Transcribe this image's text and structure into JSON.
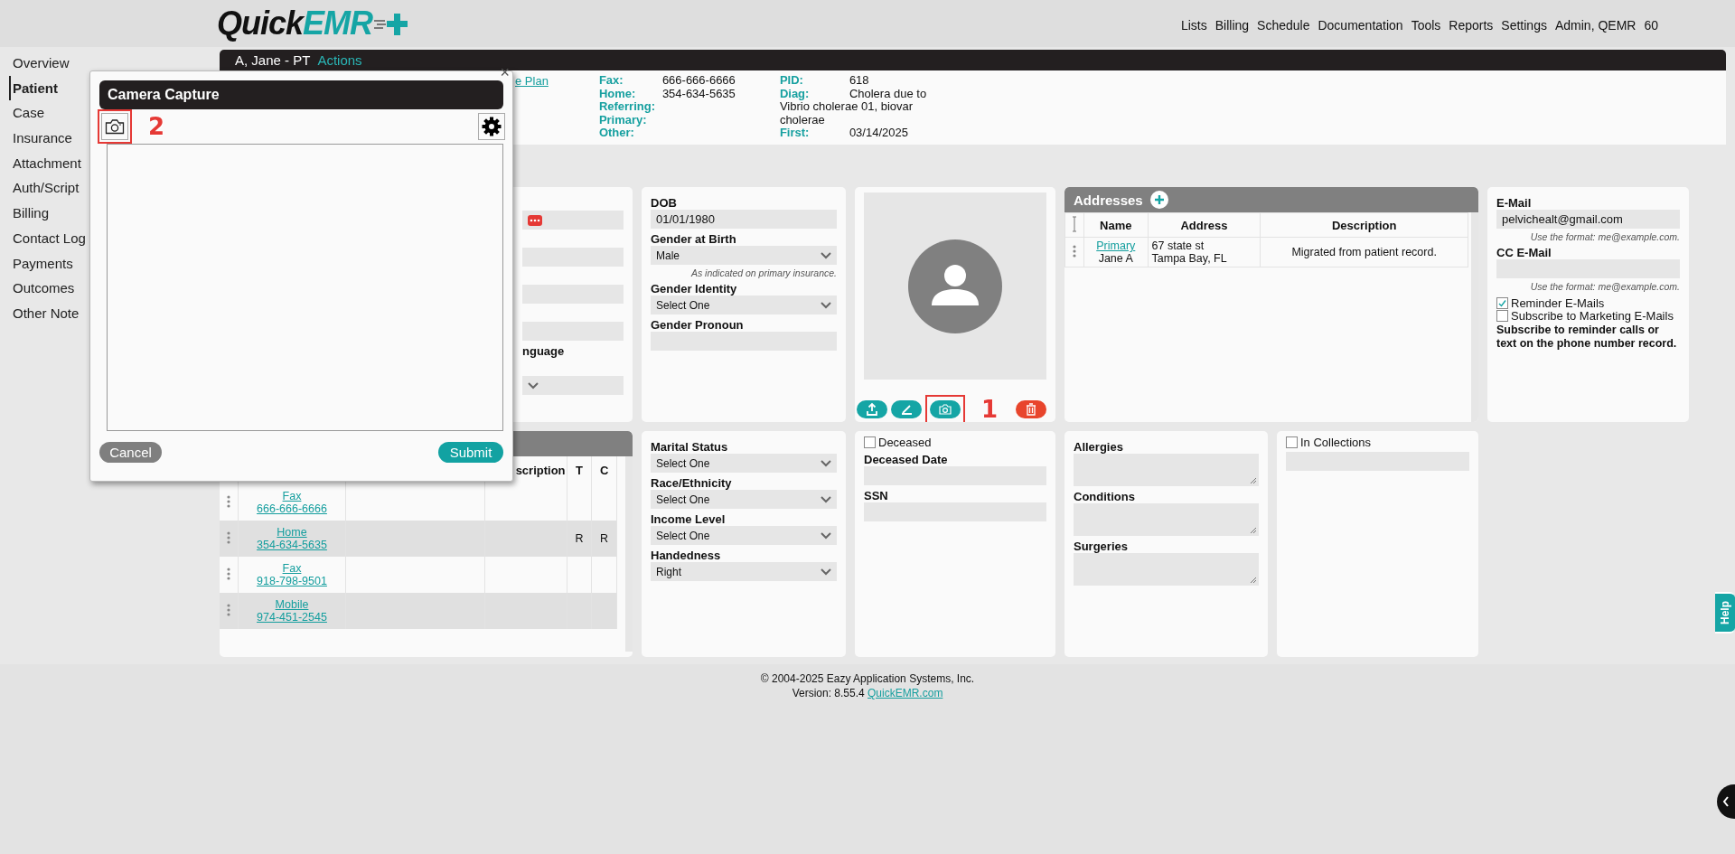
{
  "header": {
    "logo": {
      "primary": "Quick",
      "accent": "EMR"
    },
    "nav": [
      {
        "label": "Lists"
      },
      {
        "label": "Billing"
      },
      {
        "label": "Schedule"
      },
      {
        "label": "Documentation"
      },
      {
        "label": "Tools"
      },
      {
        "label": "Reports"
      },
      {
        "label": "Settings"
      },
      {
        "label": "Admin, QEMR"
      },
      {
        "label": "60"
      }
    ]
  },
  "sidebar": {
    "items": [
      {
        "label": "Overview",
        "selected": false
      },
      {
        "label": "Patient",
        "selected": true
      },
      {
        "label": "Case",
        "selected": false
      },
      {
        "label": "Insurance",
        "selected": false
      },
      {
        "label": "Attachment",
        "selected": false
      },
      {
        "label": "Auth/Script",
        "selected": false
      },
      {
        "label": "Billing",
        "selected": false
      },
      {
        "label": "Contact Log",
        "selected": false
      },
      {
        "label": "Payments",
        "selected": false
      },
      {
        "label": "Outcomes",
        "selected": false
      },
      {
        "label": "Other Note",
        "selected": false
      }
    ]
  },
  "patient_bar": {
    "name": "A, Jane - PT",
    "actions": "Actions"
  },
  "summary": {
    "link": "e Plan",
    "contacts": [
      {
        "label": "Fax:",
        "value": "666-666-6666"
      },
      {
        "label": "Home:",
        "value": "354-634-5635"
      },
      {
        "label": "Referring:"
      },
      {
        "label": "Primary:"
      },
      {
        "label": "Other:"
      }
    ],
    "details": [
      {
        "label": "PID:",
        "value": "618"
      },
      {
        "label": "Diag:",
        "value": "Cholera due to Vibrio cholerae 01, biovar cholerae"
      },
      {
        "label": "First:",
        "value": "03/14/2025"
      }
    ]
  },
  "patient_card": {
    "fields": [
      {
        "kind": "input",
        "action": true
      },
      {
        "kind": "input",
        "action": false
      },
      {
        "kind": "input",
        "action": false
      },
      {
        "kind": "input",
        "action": false
      },
      {
        "kind": "select",
        "label": "nguage"
      }
    ]
  },
  "demographics": {
    "fields": [
      {
        "kind": "input",
        "label": "DOB",
        "value": "01/01/1980"
      },
      {
        "kind": "select",
        "label": "Gender at Birth",
        "value": "Male",
        "hint": "As indicated on primary insurance."
      },
      {
        "kind": "select",
        "label": "Gender Identity",
        "value": "Select One"
      },
      {
        "kind": "input",
        "label": "Gender Pronoun"
      }
    ]
  },
  "photo": {
    "buttons": [
      {
        "kind": "upload"
      },
      {
        "kind": "sign"
      },
      {
        "kind": "camera",
        "highlight": "1"
      },
      {
        "kind": "delete"
      }
    ]
  },
  "addresses": {
    "title": "Addresses",
    "columns": [
      "Name",
      "Address",
      "Description"
    ],
    "rows": [
      {
        "name": "Primary",
        "person": "Jane A",
        "address": [
          "67 state st",
          "Tampa Bay, FL"
        ],
        "description": "Migrated from patient record."
      }
    ]
  },
  "email": {
    "fields": [
      {
        "kind": "input",
        "label": "E-Mail",
        "value": "pelvichealt@gmail.com",
        "hint": "Use the format: me@example.com."
      },
      {
        "kind": "input",
        "label": "CC E-Mail",
        "hint": "Use the format: me@example.com."
      }
    ],
    "options": [
      {
        "label": "Reminder E-Mails",
        "checked": true
      },
      {
        "label": "Subscribe to Marketing E-Mails",
        "checked": false
      }
    ],
    "note": "Subscribe to reminder calls or text on the phone number record."
  },
  "phones": {
    "columns": [
      "scription",
      "T",
      "C"
    ],
    "rows": [
      {
        "type": "Fax",
        "number": "666-666-6666"
      },
      {
        "type": "Home",
        "number": "354-634-5635",
        "t": "R",
        "c": "R"
      },
      {
        "type": "Fax",
        "number": "918-798-9501"
      },
      {
        "type": "Mobile",
        "number": "974-451-2545"
      }
    ]
  },
  "social": {
    "fields": [
      {
        "kind": "select",
        "label": "Marital Status",
        "value": "Select One"
      },
      {
        "kind": "select",
        "label": "Race/Ethnicity",
        "value": "Select One"
      },
      {
        "kind": "select",
        "label": "Income Level",
        "value": "Select One"
      },
      {
        "kind": "select",
        "label": "Handedness",
        "value": "Right"
      }
    ]
  },
  "deceased": {
    "option": {
      "label": "Deceased",
      "checked": false
    },
    "fields": [
      {
        "kind": "input",
        "label": "Deceased Date"
      },
      {
        "kind": "input",
        "label": "SSN"
      }
    ]
  },
  "history": {
    "fields": [
      {
        "kind": "textarea",
        "label": "Allergies"
      },
      {
        "kind": "textarea",
        "label": "Conditions"
      },
      {
        "kind": "textarea",
        "label": "Surgeries"
      }
    ]
  },
  "collections": {
    "option": {
      "label": "In Collections",
      "checked": false
    }
  },
  "footer": {
    "copyright": "© 2004-2025 Eazy Application Systems, Inc.",
    "version": "Version: 8.55.4",
    "link": "QuickEMR.com"
  },
  "help": "Help",
  "dialog": {
    "title": "Camera Capture",
    "close": "×",
    "capture_highlight": "2",
    "buttons": [
      {
        "label": "Cancel",
        "kind": "secondary"
      },
      {
        "label": "Submit",
        "kind": "primary"
      }
    ]
  }
}
